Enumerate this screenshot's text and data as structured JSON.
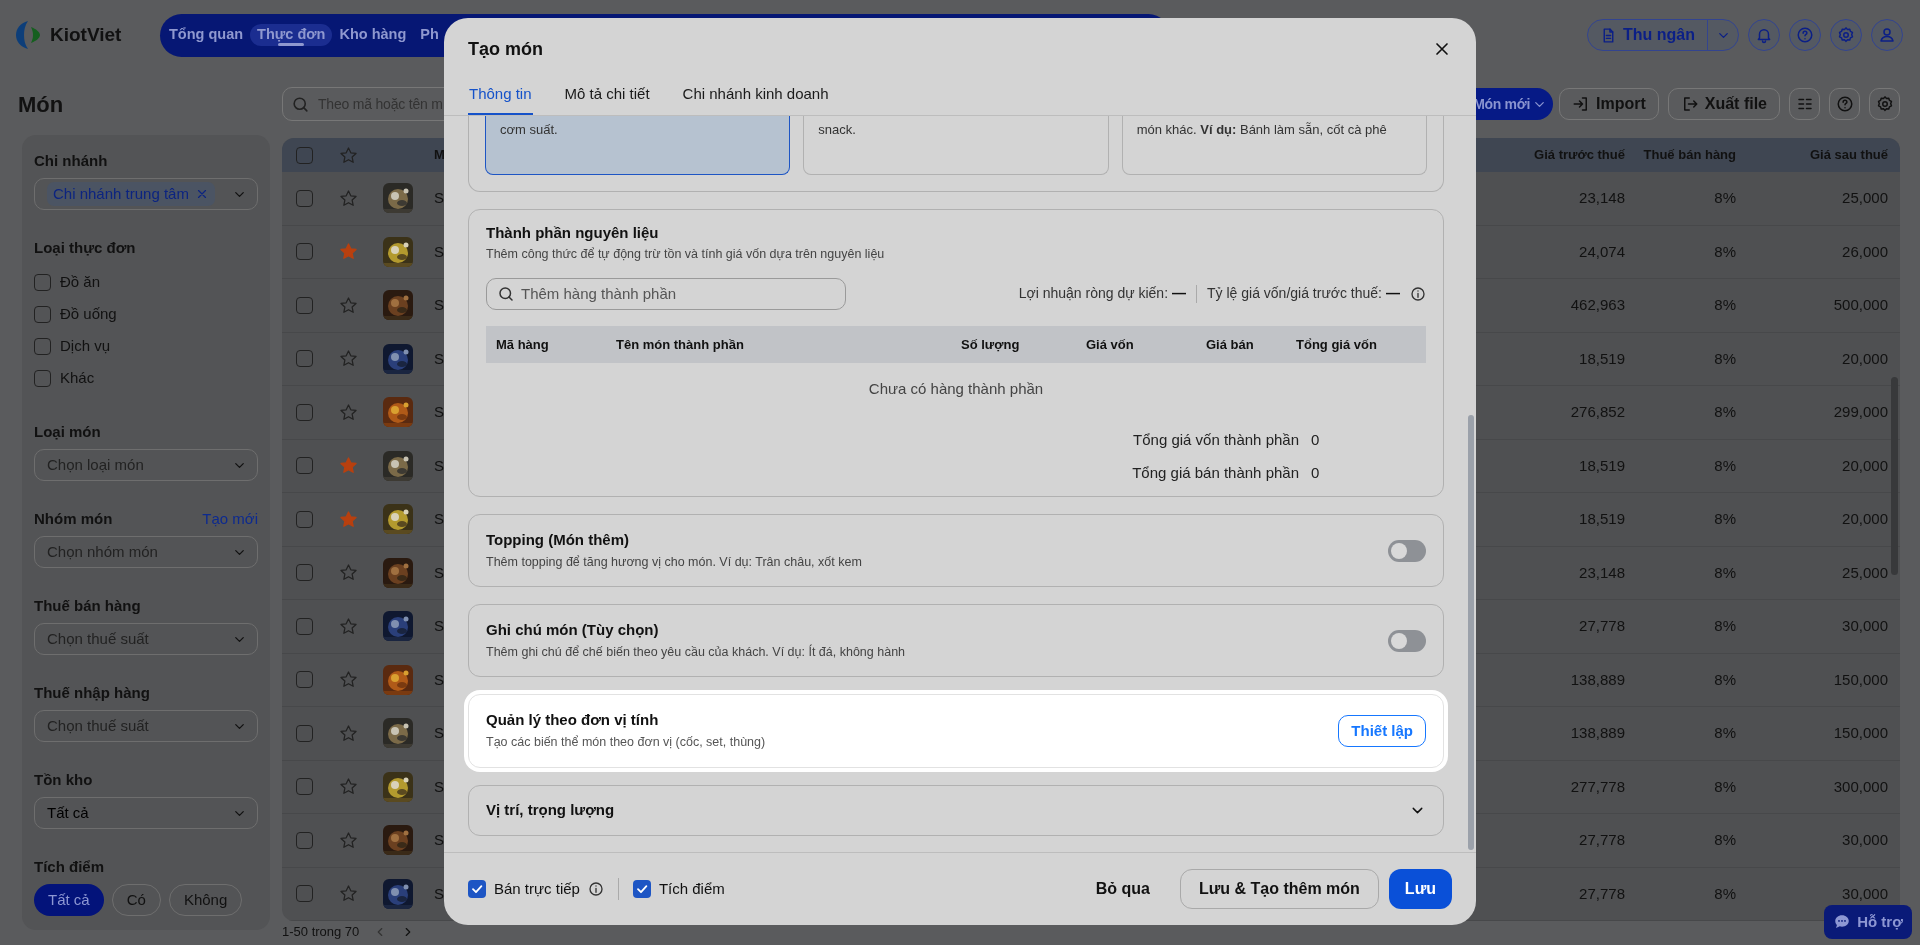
{
  "header": {
    "brand": "KiotViet",
    "nav": [
      {
        "label": "Tổng quan",
        "selected": false
      },
      {
        "label": "Thực đơn",
        "selected": true
      },
      {
        "label": "Kho hàng",
        "selected": false
      },
      {
        "label": "Ph",
        "selected": false
      }
    ],
    "cashier_button": "Thu ngân"
  },
  "toolbar": {
    "title": "Món",
    "search": {
      "placeholder": "Theo mã hoặc tên m"
    },
    "buttons": [
      {
        "label": "Món mới",
        "kind": "primary"
      },
      {
        "label": "Import",
        "kind": "import"
      },
      {
        "label": "Xuất file",
        "kind": "export"
      }
    ]
  },
  "sidebar": {
    "filters": [
      {
        "kind": "tags",
        "label": "Chi nhánh",
        "tags": [
          "Chi nhánh trung tâm"
        ]
      },
      {
        "kind": "checkboxes",
        "label": "Loại thực đơn",
        "options": [
          {
            "label": "Đồ ăn",
            "checked": false
          },
          {
            "label": "Đồ uống",
            "checked": false
          },
          {
            "label": "Dịch vụ",
            "checked": false
          },
          {
            "label": "Khác",
            "checked": false
          }
        ]
      },
      {
        "kind": "select",
        "label": "Loại món",
        "placeholder": "Chọn loại món"
      },
      {
        "kind": "select",
        "label": "Nhóm món",
        "placeholder": "Chọn nhóm món",
        "action": "Tạo mới"
      },
      {
        "kind": "select",
        "label": "Thuế bán hàng",
        "placeholder": "Chọn thuế suất"
      },
      {
        "kind": "select",
        "label": "Thuế nhập hàng",
        "placeholder": "Chọn thuế suất"
      },
      {
        "kind": "select",
        "label": "Tồn kho",
        "value": "Tất cả"
      },
      {
        "kind": "segments",
        "label": "Tích điểm",
        "options": [
          {
            "label": "Tất cả",
            "selected": true
          },
          {
            "label": "Có",
            "selected": false
          },
          {
            "label": "Không",
            "selected": false
          }
        ]
      }
    ]
  },
  "table": {
    "header_checked": false,
    "columns": [
      "M",
      "Giá trước thuế",
      "Thuế bán hàng",
      "Giá sau thuế"
    ],
    "rows": [
      {
        "checked": false,
        "starred": false,
        "name": "S",
        "price_before_tax": "23,148",
        "tax": "8%",
        "price_after_tax": "25,000"
      },
      {
        "checked": false,
        "starred": true,
        "name": "S",
        "price_before_tax": "24,074",
        "tax": "8%",
        "price_after_tax": "26,000"
      },
      {
        "checked": false,
        "starred": false,
        "name": "S",
        "price_before_tax": "462,963",
        "tax": "8%",
        "price_after_tax": "500,000"
      },
      {
        "checked": false,
        "starred": false,
        "name": "S",
        "price_before_tax": "18,519",
        "tax": "8%",
        "price_after_tax": "20,000"
      },
      {
        "checked": false,
        "starred": false,
        "name": "S",
        "price_before_tax": "276,852",
        "tax": "8%",
        "price_after_tax": "299,000"
      },
      {
        "checked": false,
        "starred": true,
        "name": "S",
        "price_before_tax": "18,519",
        "tax": "8%",
        "price_after_tax": "20,000"
      },
      {
        "checked": false,
        "starred": true,
        "name": "S",
        "price_before_tax": "18,519",
        "tax": "8%",
        "price_after_tax": "20,000"
      },
      {
        "checked": false,
        "starred": false,
        "name": "S",
        "price_before_tax": "23,148",
        "tax": "8%",
        "price_after_tax": "25,000"
      },
      {
        "checked": false,
        "starred": false,
        "name": "S",
        "price_before_tax": "27,778",
        "tax": "8%",
        "price_after_tax": "30,000"
      },
      {
        "checked": false,
        "starred": false,
        "name": "S",
        "price_before_tax": "138,889",
        "tax": "8%",
        "price_after_tax": "150,000"
      },
      {
        "checked": false,
        "starred": false,
        "name": "S",
        "price_before_tax": "138,889",
        "tax": "8%",
        "price_after_tax": "150,000"
      },
      {
        "checked": false,
        "starred": false,
        "name": "S",
        "price_before_tax": "277,778",
        "tax": "8%",
        "price_after_tax": "300,000"
      },
      {
        "checked": false,
        "starred": false,
        "name": "S",
        "price_before_tax": "27,778",
        "tax": "8%",
        "price_after_tax": "30,000"
      },
      {
        "checked": false,
        "starred": false,
        "name": "S",
        "price_before_tax": "27,778",
        "tax": "8%",
        "price_after_tax": "30,000"
      }
    ],
    "pagination": "1-50 trong 70"
  },
  "support_button": "Hỗ trợ",
  "modal": {
    "title": "Tạo món",
    "tabs": [
      {
        "label": "Thông tin",
        "selected": true
      },
      {
        "label": "Mô tả chi tiết",
        "selected": false
      },
      {
        "label": "Chi nhánh kinh doanh",
        "selected": false
      }
    ],
    "options": [
      {
        "text": "cơm suất.",
        "selected": true
      },
      {
        "text": "snack.",
        "selected": false
      },
      {
        "text": "món khác. **Ví dụ:** Bánh làm sẵn, cốt cà phê",
        "selected": false
      }
    ],
    "ingredients": {
      "title": "Thành phần nguyên liệu",
      "description": "Thêm công thức để tự động trừ tồn và tính giá vốn dựa trên nguyên liệu",
      "search": {
        "placeholder": "Thêm hàng thành phần"
      },
      "stats": [
        {
          "label": "Lợi nhuận ròng dự kiến:",
          "value": "—"
        },
        {
          "label": "Tỷ lệ giá vốn/giá trước thuế:",
          "value": "—"
        }
      ],
      "columns": [
        "Mã hàng",
        "Tên món thành phần",
        "Số lượng",
        "Giá vốn",
        "Giá bán",
        "Tổng giá vốn"
      ],
      "empty_text": "Chưa có hàng thành phần",
      "totals": [
        {
          "label": "Tổng giá vốn thành phần",
          "value": "0"
        },
        {
          "label": "Tổng giá bán thành phần",
          "value": "0"
        }
      ]
    },
    "sections": [
      {
        "kind": "toggle",
        "title": "Topping (Món thêm)",
        "description": "Thêm topping để tăng hương vị cho món. Ví dụ: Trân châu, xốt kem",
        "on": false,
        "highlighted": false
      },
      {
        "kind": "toggle",
        "title": "Ghi chú món (Tùy chọn)",
        "description": "Thêm ghi chú để chế biến theo yêu cầu của khách. Ví dụ: Ít đá, không hành",
        "on": false,
        "highlighted": false
      },
      {
        "kind": "action",
        "title": "Quản lý theo đơn vị tính",
        "description": "Tạo các biến thể món theo đơn vị (cốc, set, thùng)",
        "button": "Thiết lập",
        "highlighted": true
      },
      {
        "kind": "collapsible",
        "title": "Vị trí, trọng lượng",
        "expanded": false,
        "highlighted": false
      }
    ],
    "footer": {
      "checkboxes": [
        {
          "label": "Bán trực tiếp",
          "checked": true,
          "info": true
        },
        {
          "label": "Tích điểm",
          "checked": true,
          "info": false
        }
      ],
      "buttons": [
        {
          "label": "Bỏ qua",
          "kind": "text"
        },
        {
          "label": "Lưu & Tạo thêm món",
          "kind": "outline"
        },
        {
          "label": "Lưu",
          "kind": "primary"
        }
      ]
    }
  }
}
